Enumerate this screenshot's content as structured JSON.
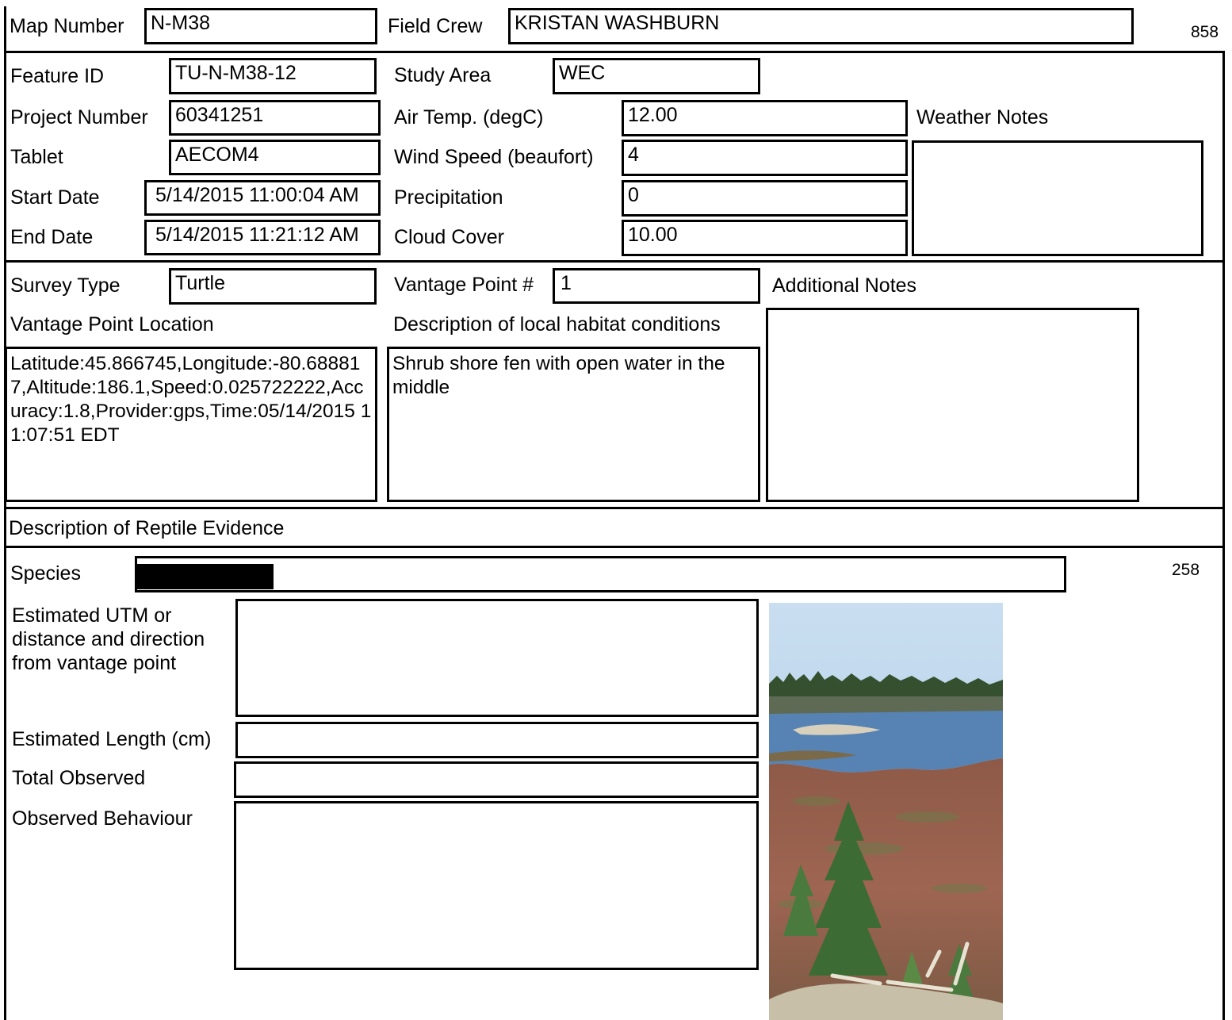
{
  "header": {
    "map_number_label": "Map Number",
    "map_number_value": "N-M38",
    "field_crew_label": "Field Crew",
    "field_crew_value": "KRISTAN WASHBURN",
    "page_code_top": "858"
  },
  "site": {
    "feature_id_label": "Feature ID",
    "feature_id_value": "TU-N-M38-12",
    "project_number_label": "Project Number",
    "project_number_value": "60341251",
    "tablet_label": "Tablet",
    "tablet_value": "AECOM4",
    "start_date_label": "Start Date",
    "start_date_value": "5/14/2015 11:00:04 AM",
    "end_date_label": "End Date",
    "end_date_value": "5/14/2015 11:21:12 AM",
    "study_area_label": "Study Area",
    "study_area_value": "WEC",
    "air_temp_label": "Air Temp. (degC)",
    "air_temp_value": "12.00",
    "wind_speed_label": "Wind Speed (beaufort)",
    "wind_speed_value": "4",
    "precipitation_label": "Precipitation",
    "precipitation_value": "0",
    "cloud_cover_label": "Cloud Cover",
    "cloud_cover_value": "10.00",
    "weather_notes_label": "Weather Notes",
    "weather_notes_value": ""
  },
  "survey": {
    "survey_type_label": "Survey Type",
    "survey_type_value": "Turtle",
    "vantage_point_label": "Vantage Point #",
    "vantage_point_value": "1",
    "additional_notes_label": "Additional Notes",
    "additional_notes_value": "",
    "vantage_location_label": "Vantage Point Location",
    "vantage_location_value": "Latitude:45.866745,Longitude:-80.688817,Altitude:186.1,Speed:0.025722222,Accuracy:1.8,Provider:gps,Time:05/14/2015 11:07:51 EDT",
    "habitat_label": "Description of local habitat conditions",
    "habitat_value": "Shrub shore fen with open water in the middle"
  },
  "evidence": {
    "section_title": "Description of Reptile Evidence",
    "species_label": "Species",
    "page_code_side": "258",
    "utm_label": "Estimated UTM or distance and direction from vantage point",
    "utm_value": "",
    "length_label": "Estimated Length (cm)",
    "length_value": "",
    "total_label": "Total Observed",
    "total_value": "",
    "behaviour_label": "Observed Behaviour",
    "behaviour_value": ""
  },
  "colors": {
    "sky": "#b9d3ea",
    "water": "#4f7fb0",
    "treeline": "#2f4a2e",
    "fen": "#9a5b4a",
    "spruce": "#3f6e35",
    "redaction": "#000000"
  }
}
